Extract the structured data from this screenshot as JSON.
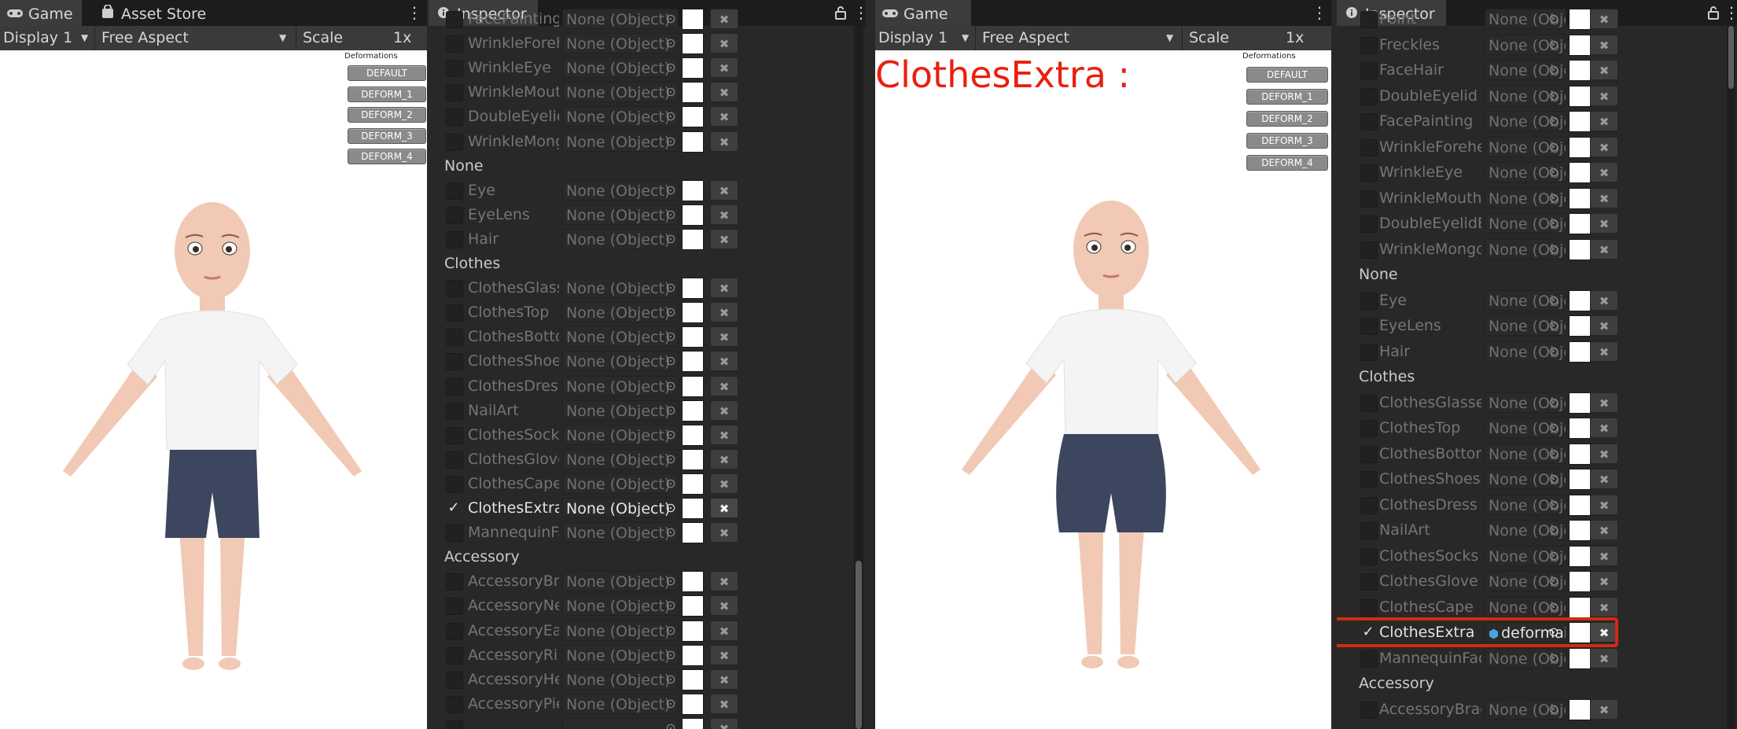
{
  "left": {
    "game": {
      "tabs": [
        {
          "label": "Game",
          "icon": "gamepad-icon"
        },
        {
          "label": "Asset Store",
          "icon": "bag-icon"
        }
      ],
      "toolbar": {
        "display": "Display 1",
        "aspect": "Free Aspect",
        "scale_label": "Scale",
        "scale_value": "1x"
      },
      "deformations": {
        "title": "Deformations",
        "buttons": [
          "DEFAULT",
          "DEFORM_1",
          "DEFORM_2",
          "DEFORM_3",
          "DEFORM_4"
        ]
      }
    },
    "inspector": {
      "tab": "Inspector",
      "sections": [
        {
          "header": "",
          "items": [
            {
              "label": "FacePainting",
              "value": "None (Object)",
              "checked": false
            },
            {
              "label": "WrinkleForehead",
              "value": "None (Object)",
              "checked": false
            },
            {
              "label": "WrinkleEye",
              "value": "None (Object)",
              "checked": false
            },
            {
              "label": "WrinkleMouth",
              "value": "None (Object)",
              "checked": false
            },
            {
              "label": "DoubleEyelidBottom",
              "value": "None (Object)",
              "checked": false
            },
            {
              "label": "WrinkleMongo",
              "value": "None (Object)",
              "checked": false
            }
          ]
        },
        {
          "header": "None",
          "items": [
            {
              "label": "Eye",
              "value": "None (Object)",
              "checked": false
            },
            {
              "label": "EyeLens",
              "value": "None (Object)",
              "checked": false
            },
            {
              "label": "Hair",
              "value": "None (Object)",
              "checked": false
            }
          ]
        },
        {
          "header": "Clothes",
          "items": [
            {
              "label": "ClothesGlasses",
              "value": "None (Object)",
              "checked": false
            },
            {
              "label": "ClothesTop",
              "value": "None (Object)",
              "checked": false
            },
            {
              "label": "ClothesBottom",
              "value": "None (Object)",
              "checked": false
            },
            {
              "label": "ClothesShoes",
              "value": "None (Object)",
              "checked": false
            },
            {
              "label": "ClothesDress",
              "value": "None (Object)",
              "checked": false
            },
            {
              "label": "NailArt",
              "value": "None (Object)",
              "checked": false
            },
            {
              "label": "ClothesSocks",
              "value": "None (Object)",
              "checked": false
            },
            {
              "label": "ClothesGlove",
              "value": "None (Object)",
              "checked": false
            },
            {
              "label": "ClothesCape",
              "value": "None (Object)",
              "checked": false
            },
            {
              "label": "ClothesExtra",
              "value": "None (Object)",
              "checked": true
            },
            {
              "label": "MannequinFace",
              "value": "None (Object)",
              "checked": false
            }
          ]
        },
        {
          "header": "Accessory",
          "items": [
            {
              "label": "AccessoryBracelet",
              "value": "None (Object)",
              "checked": false
            },
            {
              "label": "AccessoryNecklace",
              "value": "None (Object)",
              "checked": false
            },
            {
              "label": "AccessoryEarring",
              "value": "None (Object)",
              "checked": false
            },
            {
              "label": "AccessoryRing",
              "value": "None (Object)",
              "checked": false
            },
            {
              "label": "AccessoryHeadwear",
              "value": "None (Object)",
              "checked": false
            },
            {
              "label": "AccessoryPiercing",
              "value": "None (Object)",
              "checked": false
            },
            {
              "label": "",
              "value": "",
              "checked": false
            }
          ]
        }
      ]
    }
  },
  "right": {
    "game": {
      "tabs": [
        {
          "label": "Game",
          "icon": "gamepad-icon"
        }
      ],
      "toolbar": {
        "display": "Display 1",
        "aspect": "Free Aspect",
        "scale_label": "Scale",
        "scale_value": "1x"
      },
      "deformations": {
        "title": "Deformations",
        "buttons": [
          "DEFAULT",
          "DEFORM_1",
          "DEFORM_2",
          "DEFORM_3",
          "DEFORM_4"
        ]
      },
      "overlay_title": "ClothesExtra :"
    },
    "inspector": {
      "tab": "Inspector",
      "sections": [
        {
          "header": "",
          "items": [
            {
              "label": "Point",
              "value": "None (Objec",
              "checked": false
            },
            {
              "label": "Freckles",
              "value": "None (Objec",
              "checked": false
            },
            {
              "label": "FaceHair",
              "value": "None (Objec",
              "checked": false
            },
            {
              "label": "DoubleEyelid",
              "value": "None (Objec",
              "checked": false
            },
            {
              "label": "FacePainting",
              "value": "None (Objec",
              "checked": false
            },
            {
              "label": "WrinkleForehead",
              "value": "None (Objec",
              "checked": false
            },
            {
              "label": "WrinkleEye",
              "value": "None (Objec",
              "checked": false
            },
            {
              "label": "WrinkleMouth",
              "value": "None (Objec",
              "checked": false
            },
            {
              "label": "DoubleEyelidBottom",
              "value": "None (Objec",
              "checked": false
            },
            {
              "label": "WrinkleMongo",
              "value": "None (Objec",
              "checked": false
            }
          ]
        },
        {
          "header": "None",
          "items": [
            {
              "label": "Eye",
              "value": "None (Objec",
              "checked": false
            },
            {
              "label": "EyeLens",
              "value": "None (Objec",
              "checked": false
            },
            {
              "label": "Hair",
              "value": "None (Objec",
              "checked": false
            }
          ]
        },
        {
          "header": "Clothes",
          "items": [
            {
              "label": "ClothesGlasses",
              "value": "None (Objec",
              "checked": false
            },
            {
              "label": "ClothesTop",
              "value": "None (Objec",
              "checked": false
            },
            {
              "label": "ClothesBottom",
              "value": "None (Objec",
              "checked": false
            },
            {
              "label": "ClothesShoes",
              "value": "None (Objec",
              "checked": false
            },
            {
              "label": "ClothesDress",
              "value": "None (Objec",
              "checked": false
            },
            {
              "label": "NailArt",
              "value": "None (Objec",
              "checked": false
            },
            {
              "label": "ClothesSocks",
              "value": "None (Objec",
              "checked": false
            },
            {
              "label": "ClothesGlove",
              "value": "None (Objec",
              "checked": false
            },
            {
              "label": "ClothesCape",
              "value": "None (Objec",
              "checked": false
            },
            {
              "label": "ClothesExtra",
              "value": "deformaio",
              "checked": true,
              "highlight": true
            },
            {
              "label": "MannequinFace",
              "value": "None (Objec",
              "checked": false
            }
          ]
        },
        {
          "header": "Accessory",
          "items": [
            {
              "label": "AccessoryBracelet",
              "value": "None (Objec",
              "checked": false
            }
          ]
        }
      ]
    }
  },
  "colors": {
    "highlight_box": "#d12b12",
    "overlay_text": "#e8200f",
    "shorts": "#3d465f",
    "shirt": "#f4f4f4",
    "skin": "#f1c9b4"
  }
}
